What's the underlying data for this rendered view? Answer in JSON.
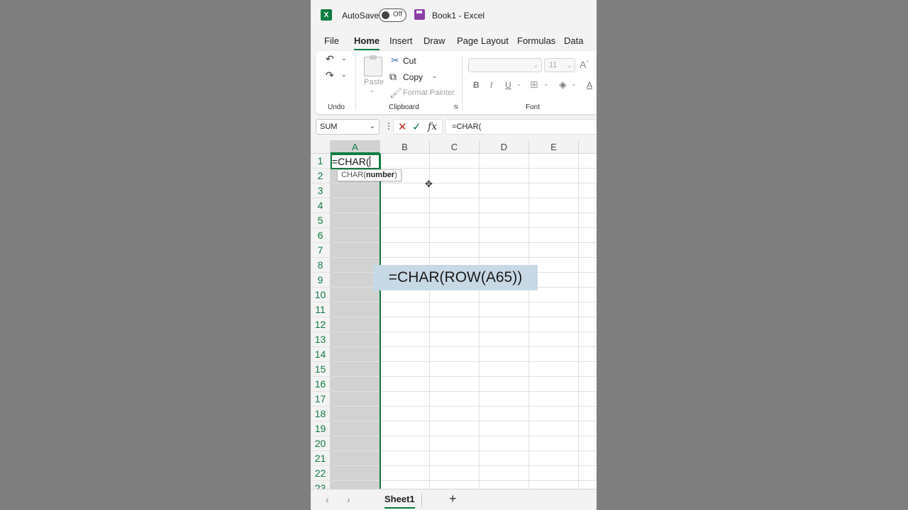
{
  "titlebar": {
    "autosave_label": "AutoSave",
    "autosave_state": "Off",
    "doc_title": "Book1  -  Excel"
  },
  "tabs": [
    {
      "label": "File",
      "active": false
    },
    {
      "label": "Home",
      "active": true
    },
    {
      "label": "Insert",
      "active": false
    },
    {
      "label": "Draw",
      "active": false
    },
    {
      "label": "Page Layout",
      "active": false
    },
    {
      "label": "Formulas",
      "active": false
    },
    {
      "label": "Data",
      "active": false
    }
  ],
  "ribbon": {
    "undo_group": "Undo",
    "clipboard": {
      "paste": "Paste",
      "cut": "Cut",
      "copy": "Copy",
      "format_painter": "Format Painter",
      "group_label": "Clipboard"
    },
    "font": {
      "size": "11",
      "bold": "B",
      "italic": "I",
      "underline": "U",
      "group_label": "Font"
    }
  },
  "formula_bar": {
    "name_box": "SUM",
    "fx": "fx",
    "content": "=CHAR("
  },
  "grid": {
    "columns": [
      "A",
      "B",
      "C",
      "D",
      "E"
    ],
    "rows": [
      "1",
      "2",
      "3",
      "4",
      "5",
      "6",
      "7",
      "8",
      "9",
      "10",
      "11",
      "12",
      "13",
      "14",
      "15",
      "16",
      "17",
      "18",
      "19",
      "20",
      "21",
      "22",
      "23"
    ],
    "active_cell_text": "=CHAR(",
    "tooltip_func": "CHAR(",
    "tooltip_arg": "number",
    "tooltip_close": ")"
  },
  "overlay": {
    "formula": "=CHAR(ROW(A65))"
  },
  "sheets": {
    "active": "Sheet1",
    "add": "+"
  },
  "colors": {
    "accent": "#107c41",
    "overlay_bg": "#c8d9e6"
  }
}
